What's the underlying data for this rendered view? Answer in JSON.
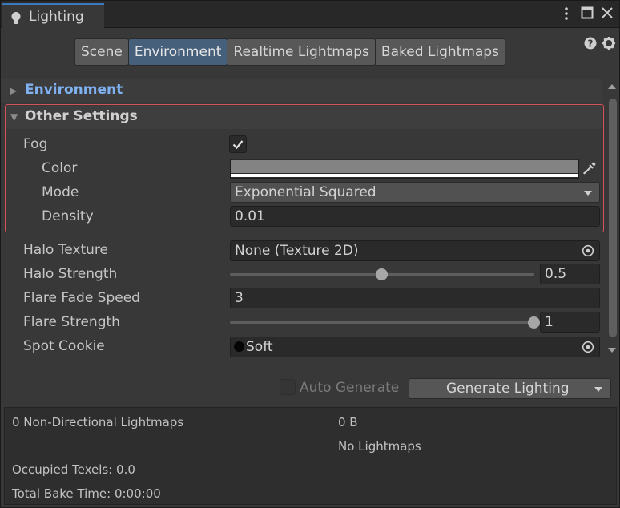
{
  "window": {
    "tab_title": "Lighting",
    "tab_icon": "lightbulb-icon"
  },
  "toolbar": {
    "tabs": [
      {
        "label": "Scene",
        "active": false
      },
      {
        "label": "Environment",
        "active": true
      },
      {
        "label": "Realtime Lightmaps",
        "active": false
      },
      {
        "label": "Baked Lightmaps",
        "active": false
      }
    ]
  },
  "sections": {
    "environment": {
      "label": "Environment",
      "expanded": false
    },
    "other_settings": {
      "label": "Other Settings",
      "expanded": true
    }
  },
  "fog": {
    "label": "Fog",
    "enabled": true,
    "color_label": "Color",
    "color": "#838383",
    "mode_label": "Mode",
    "mode_value": "Exponential Squared",
    "density_label": "Density",
    "density_value": "0.01"
  },
  "halo": {
    "texture_label": "Halo Texture",
    "texture_value": "None (Texture 2D)",
    "strength_label": "Halo Strength",
    "strength_value": "0.5",
    "strength_fraction": 0.5
  },
  "flare": {
    "fade_label": "Flare Fade Speed",
    "fade_value": "3",
    "strength_label": "Flare Strength",
    "strength_value": "1",
    "strength_fraction": 1.0
  },
  "spot_cookie": {
    "label": "Spot Cookie",
    "value": "Soft"
  },
  "generate": {
    "auto_label": "Auto Generate",
    "auto_enabled": false,
    "button_label": "Generate Lighting"
  },
  "stats": {
    "lightmaps": "0 Non-Directional Lightmaps",
    "size": "0 B",
    "no_lightmaps": "No Lightmaps",
    "occupied": "Occupied Texels: 0.0",
    "bake_time": "Total Bake Time: 0:00:00"
  },
  "colors": {
    "accent": "#3a79bb",
    "active_tab": "#46607c",
    "highlight_border": "#d8505a",
    "section_link": "#7fb0f0"
  }
}
